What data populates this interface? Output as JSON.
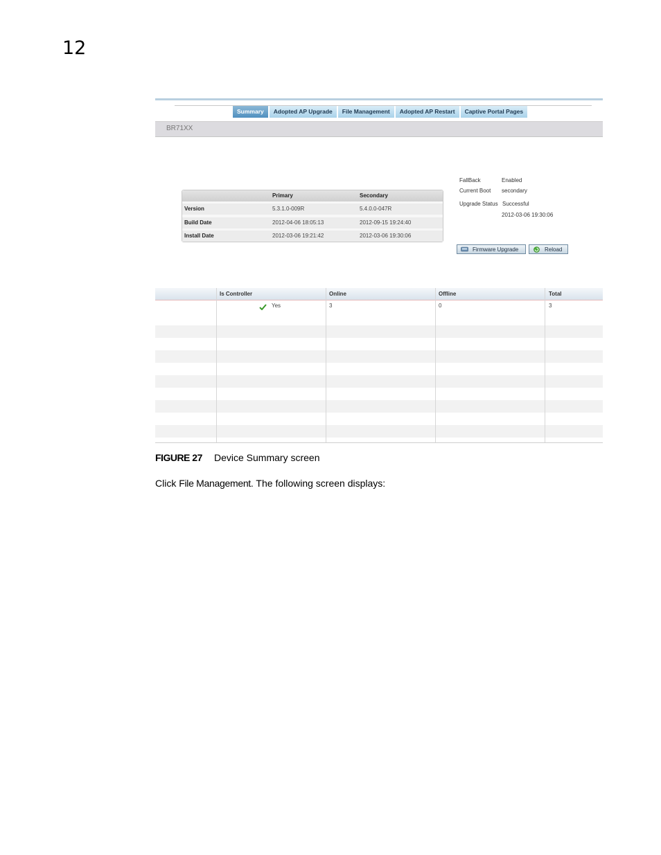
{
  "chapter_number": "12",
  "tabs": [
    {
      "label": "Summary",
      "active": true
    },
    {
      "label": "Adopted AP Upgrade",
      "active": false
    },
    {
      "label": "File Management",
      "active": false
    },
    {
      "label": "Adopted AP Restart",
      "active": false
    },
    {
      "label": "Captive Portal Pages",
      "active": false
    }
  ],
  "device_name": "BR71XX",
  "version_table": {
    "headers": {
      "primary": "Primary",
      "secondary": "Secondary"
    },
    "rows": [
      {
        "label": "Version",
        "primary": "5.3.1.0-009R",
        "secondary": "5.4.0.0-047R"
      },
      {
        "label": "Build Date",
        "primary": "2012-04-06 18:05:13",
        "secondary": "2012-09-15 19:24:40"
      },
      {
        "label": "Install Date",
        "primary": "2012-03-06 19:21:42",
        "secondary": "2012-03-06 19:30:06"
      }
    ]
  },
  "status": {
    "fallback_label": "FallBack",
    "fallback_value": "Enabled",
    "current_boot_label": "Current Boot",
    "current_boot_value": "secondary",
    "upgrade_status_label": "Upgrade Status",
    "upgrade_status_value": "Successful",
    "upgrade_time": "2012-03-06 19:30:06"
  },
  "buttons": {
    "firmware_upgrade": "Firmware Upgrade",
    "reload": "Reload"
  },
  "controller_table": {
    "headers": [
      "",
      "Is Controller",
      "Online",
      "Offline",
      "Total"
    ],
    "row": {
      "is_controller": "Yes",
      "online": "3",
      "offline": "0",
      "total": "3"
    }
  },
  "caption": {
    "figure": "FIGURE 27",
    "title": "Device Summary screen"
  },
  "body": {
    "prefix": "Click ",
    "emphasis": "File Management",
    "suffix": ". The following screen displays:"
  },
  "colors": {
    "tab_active": "#4f8fbf",
    "tab_inactive": "#a9d2ea",
    "check_green": "#3a9a2a"
  }
}
